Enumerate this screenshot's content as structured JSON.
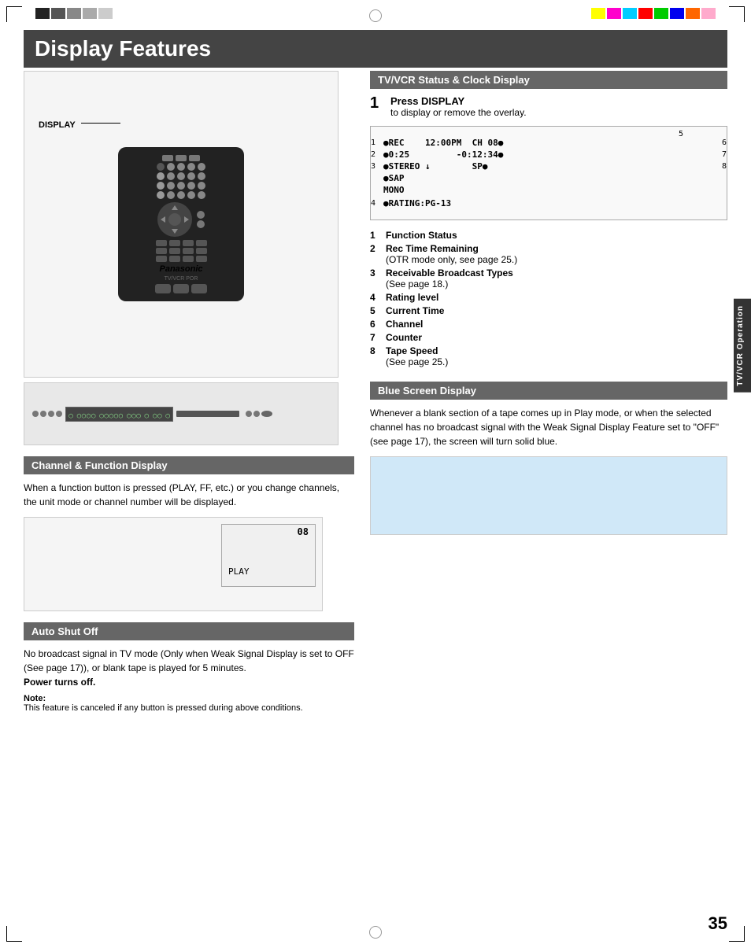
{
  "page": {
    "title": "Display Features",
    "number": "35",
    "tab_label": "TV/VCR Operation"
  },
  "tv_vcr_section": {
    "header": "TV/VCR Status & Clock Display",
    "step1": {
      "number": "1",
      "action": "Press DISPLAY",
      "description": "to display or remove the overlay."
    },
    "status_display": {
      "top_number": "5",
      "row1": {
        "left_num": "1",
        "right_num": "6",
        "content": "●REC    12:00PM  CH 08●"
      },
      "row2": {
        "left_num": "2",
        "right_num": "7",
        "content": "●0:25          -0:12:34●"
      },
      "row3": {
        "left_num": "3",
        "right_num": "8",
        "content": "●STEREO ↓         SP●",
        "extra": "●SAP"
      },
      "row3b": "MONO",
      "row4": {
        "left_num": "4",
        "content": "●RATING:PG-13"
      }
    },
    "features": [
      {
        "num": "1",
        "label": "Function Status",
        "extra": ""
      },
      {
        "num": "2",
        "label": "Rec Time Remaining",
        "extra": "(OTR mode only, see page 25.)"
      },
      {
        "num": "3",
        "label": "Receivable Broadcast Types",
        "extra": "(See page 18.)"
      },
      {
        "num": "4",
        "label": "Rating level",
        "extra": ""
      },
      {
        "num": "5",
        "label": "Current Time",
        "extra": ""
      },
      {
        "num": "6",
        "label": "Channel",
        "extra": ""
      },
      {
        "num": "7",
        "label": "Counter",
        "extra": ""
      },
      {
        "num": "8",
        "label": "Tape Speed",
        "extra": "(See page 25.)"
      }
    ]
  },
  "channel_section": {
    "header": "Channel & Function Display",
    "description": "When a function button is pressed (PLAY, FF, etc.) or you change channels, the unit mode or channel number will be displayed.",
    "ch_display": {
      "channel": "08",
      "mode": "PLAY"
    }
  },
  "shutoff_section": {
    "header": "Auto Shut Off",
    "description": "No broadcast signal in TV mode (Only when Weak Signal Display is set to OFF (See page 17)), or blank tape is played for 5 minutes.",
    "bold_text": "Power turns off.",
    "note_title": "Note:",
    "note_text": "This feature is canceled if any button is pressed during above conditions."
  },
  "blue_section": {
    "header": "Blue Screen Display",
    "description": "Whenever a blank section of a tape comes up in Play mode, or when the selected channel has no broadcast signal with the Weak Signal Display Feature set to \"OFF\" (see page 17), the screen will turn solid blue."
  },
  "display_arrow": "DISPLAY",
  "colors": {
    "header_bg": "#444",
    "section_header_bg": "#666",
    "tab_bg": "#333",
    "swatches": [
      "#ffff00",
      "#ff00ff",
      "#00ffff",
      "#ff0000",
      "#00cc00",
      "#0000ff",
      "#ff6600",
      "#ffaacc"
    ]
  }
}
